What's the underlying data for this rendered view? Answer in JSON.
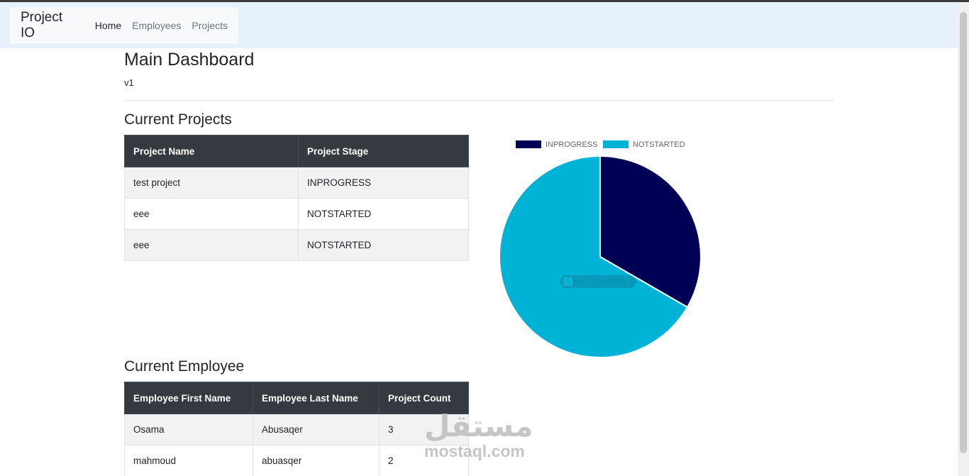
{
  "nav": {
    "brand": "Project IO",
    "links": [
      {
        "label": "Home",
        "active": true
      },
      {
        "label": "Employees",
        "active": false
      },
      {
        "label": "Projects",
        "active": false
      }
    ]
  },
  "header": {
    "title": "Main Dashboard",
    "version": "v1"
  },
  "projects": {
    "title": "Current Projects",
    "columns": [
      "Project Name",
      "Project Stage"
    ],
    "rows": [
      [
        "test project",
        "INPROGRESS"
      ],
      [
        "eee",
        "NOTSTARTED"
      ],
      [
        "eee",
        "NOTSTARTED"
      ]
    ]
  },
  "employees": {
    "title": "Current Employee",
    "columns": [
      "Employee First Name",
      "Employee Last Name",
      "Project Count"
    ],
    "rows": [
      [
        "Osama",
        "Abusaqer",
        "3"
      ],
      [
        "mahmoud",
        "abuasqer",
        "2"
      ]
    ]
  },
  "chart_data": {
    "type": "pie",
    "categories": [
      "INPROGRESS",
      "NOTSTARTED"
    ],
    "values": [
      1,
      2
    ],
    "colors": [
      "#000055",
      "#00b3d6"
    ],
    "legend": "top",
    "tooltip": {
      "label": "NOTSTARTED",
      "value": 2
    }
  },
  "watermark": {
    "text": "مستقل",
    "url": "mostaql.com"
  }
}
